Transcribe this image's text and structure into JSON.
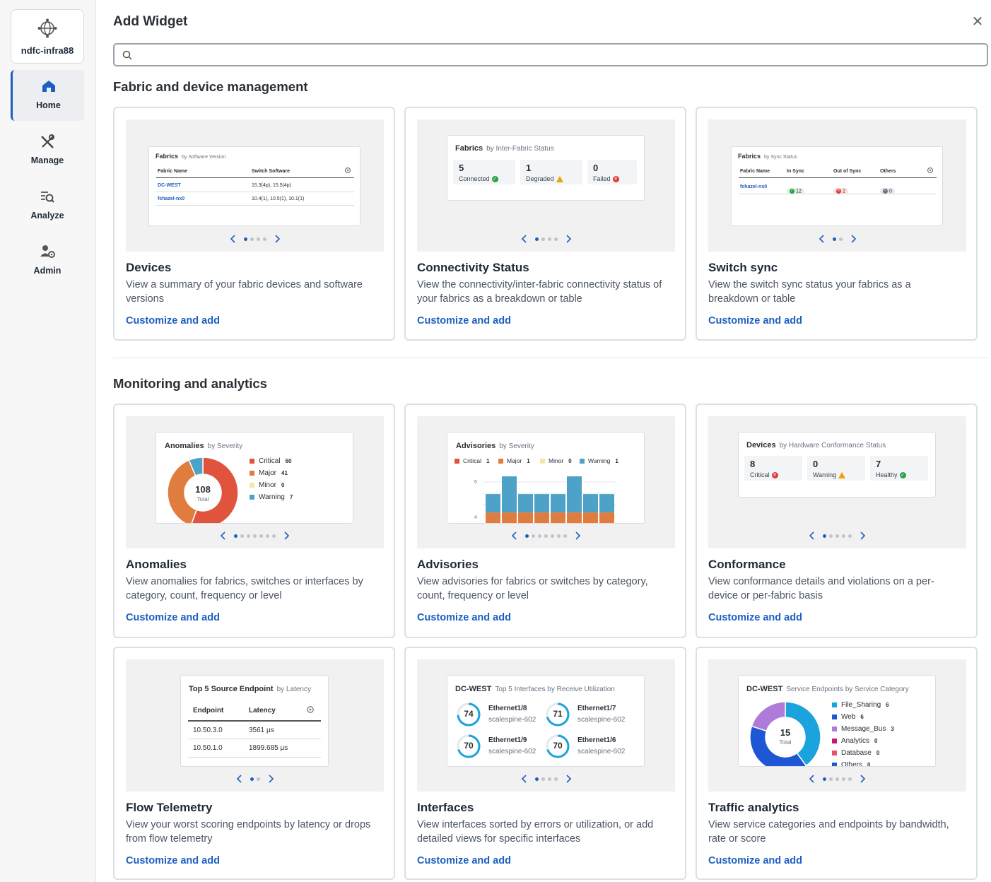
{
  "site": {
    "name": "ndfc-infra88"
  },
  "nav": [
    {
      "label": "Home"
    },
    {
      "label": "Manage"
    },
    {
      "label": "Analyze"
    },
    {
      "label": "Admin"
    }
  ],
  "dialog": {
    "title": "Add Widget",
    "search_placeholder": ""
  },
  "sections": [
    {
      "title": "Fabric and device management"
    },
    {
      "title": "Monitoring and analytics"
    }
  ],
  "link_label": "Customize and add",
  "cards": {
    "devices": {
      "title": "Devices",
      "desc": "View a summary of your fabric devices and software versions",
      "preview": {
        "title": "Fabrics",
        "subtitle": "by Software Version",
        "headers": [
          "Fabric Name",
          "Switch Software"
        ],
        "rows": [
          [
            "DC-WEST",
            "15.3(4p), 15.5(4p)"
          ],
          [
            "fchazel-nx0",
            "10.4(1), 10.5(1), 10.1(1)"
          ]
        ]
      },
      "pages": 4,
      "page": 1
    },
    "connectivity": {
      "title": "Connectivity Status",
      "desc": "View the connectivity/inter-fabric connectivity status of your fabrics as a breakdown or table",
      "preview": {
        "title": "Fabrics",
        "subtitle": "by Inter-Fabric Status",
        "stats": [
          {
            "n": "5",
            "l": "Connected"
          },
          {
            "n": "1",
            "l": "Degraded"
          },
          {
            "n": "0",
            "l": "Failed"
          }
        ]
      },
      "pages": 4,
      "page": 1
    },
    "switch_sync": {
      "title": "Switch sync",
      "desc": "View the switch sync status your fabrics as a breakdown or table",
      "preview": {
        "title": "Fabrics",
        "subtitle": "by Sync Status",
        "headers": [
          "Fabric Name",
          "In Sync",
          "Out of Sync",
          "Others"
        ],
        "row": {
          "name": "fchazel-nx0",
          "in_sync": "12",
          "out_sync": "2",
          "others": "0"
        }
      },
      "pages": 2,
      "page": 1
    },
    "anomalies": {
      "title": "Anomalies",
      "desc": "View anomalies for fabrics, switches or interfaces by category, count, frequency or level",
      "preview": {
        "title": "Anomalies",
        "subtitle": "by Severity",
        "total": "108",
        "total_label": "Total",
        "legend": [
          {
            "name": "Critical",
            "value": "60",
            "color": "#e0533c"
          },
          {
            "name": "Major",
            "value": "41",
            "color": "#e07c3e"
          },
          {
            "name": "Minor",
            "value": "0",
            "color": "#f5e6a5"
          },
          {
            "name": "Warning",
            "value": "7",
            "color": "#4ea2c8"
          }
        ]
      },
      "pages": 7,
      "page": 1
    },
    "advisories": {
      "title": "Advisories",
      "desc": "View advisories for fabrics or switches by category, count, frequency or level",
      "preview": {
        "title": "Advisories",
        "subtitle": "by Severity",
        "legend": [
          {
            "name": "Critical",
            "value": "1",
            "color": "#e0533c"
          },
          {
            "name": "Major",
            "value": "1",
            "color": "#e07c3e"
          },
          {
            "name": "Minor",
            "value": "0",
            "color": "#f5e6a5"
          },
          {
            "name": "Warning",
            "value": "1",
            "color": "#4ea2c8"
          }
        ],
        "yticks": [
          "6",
          "4"
        ]
      },
      "pages": 7,
      "page": 1
    },
    "conformance": {
      "title": "Conformance",
      "desc": "View conformance details and violations on a per-device or per-fabric basis",
      "preview": {
        "title": "Devices",
        "subtitle": "by Hardware Conformance Status",
        "stats": [
          {
            "n": "8",
            "l": "Critical"
          },
          {
            "n": "0",
            "l": "Warning"
          },
          {
            "n": "7",
            "l": "Healthy"
          }
        ]
      },
      "pages": 5,
      "page": 1
    },
    "flow": {
      "title": "Flow Telemetry",
      "desc": "View your worst scoring endpoints by latency or drops from flow telemetry",
      "preview": {
        "title": "Top 5 Source Endpoint",
        "subtitle": "by Latency",
        "headers": [
          "Endpoint",
          "Latency"
        ],
        "rows": [
          [
            "10.50.3.0",
            "3561 µs"
          ],
          [
            "10.50.1.0",
            "1899.685 µs"
          ]
        ]
      },
      "pages": 2,
      "page": 1
    },
    "interfaces": {
      "title": "Interfaces",
      "desc": "View interfaces sorted by errors or utilization, or add detailed views for specific interfaces",
      "preview": {
        "title": "DC-WEST",
        "subtitle": "Top 5 Interfaces by Receive Utilization",
        "items": [
          {
            "v": "74",
            "name": "Ethernet1/8",
            "sw": "scalespine-602"
          },
          {
            "v": "71",
            "name": "Ethernet1/7",
            "sw": "scalespine-602"
          },
          {
            "v": "70",
            "name": "Ethernet1/9",
            "sw": "scalespine-602"
          },
          {
            "v": "70",
            "name": "Ethernet1/6",
            "sw": "scalespine-602"
          }
        ]
      },
      "pages": 4,
      "page": 1
    },
    "traffic": {
      "title": "Traffic analytics",
      "desc": "View service categories and endpoints by bandwidth, rate or score",
      "preview": {
        "title": "DC-WEST",
        "subtitle": "Service Endpoints by Service Category",
        "total": "15",
        "total_label": "Total",
        "legend": [
          {
            "name": "File_Sharing",
            "value": "6",
            "color": "#1aa3dc"
          },
          {
            "name": "Web",
            "value": "6",
            "color": "#1f56d6"
          },
          {
            "name": "Message_Bus",
            "value": "3",
            "color": "#b07ad8"
          },
          {
            "name": "Analytics",
            "value": "0",
            "color": "#c8167c"
          },
          {
            "name": "Database",
            "value": "0",
            "color": "#e8506c"
          },
          {
            "name": "Others",
            "value": "0",
            "color": "#1d5fc0"
          }
        ]
      },
      "pages": 5,
      "page": 1
    }
  },
  "chart_data": [
    {
      "type": "pie",
      "title": "Anomalies",
      "subtitle": "by Severity",
      "categories": [
        "Critical",
        "Major",
        "Minor",
        "Warning"
      ],
      "values": [
        60,
        41,
        0,
        7
      ],
      "total": 108
    },
    {
      "type": "bar",
      "title": "Advisories",
      "subtitle": "by Severity",
      "series": [
        {
          "name": "Major",
          "values": [
            1,
            1,
            1,
            1,
            1,
            1,
            1,
            1
          ]
        },
        {
          "name": "Warning",
          "values": [
            1,
            2,
            1,
            1,
            1,
            2,
            1,
            1
          ]
        }
      ],
      "yticks": [
        4,
        6
      ]
    },
    {
      "type": "pie",
      "title": "DC-WEST",
      "subtitle": "Service Endpoints by Service Category",
      "categories": [
        "File_Sharing",
        "Web",
        "Message_Bus",
        "Analytics",
        "Database",
        "Others"
      ],
      "values": [
        6,
        6,
        3,
        0,
        0,
        0
      ],
      "total": 15
    }
  ]
}
